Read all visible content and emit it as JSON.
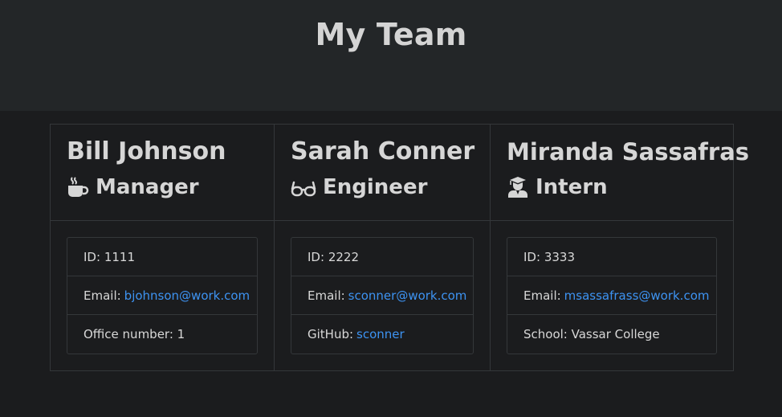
{
  "header": {
    "title": "My Team"
  },
  "colors": {
    "background": "#1b1c1e",
    "header_bg": "#232628",
    "link": "#3d93f2",
    "border": "#34373a"
  },
  "team": [
    {
      "name": "Bill Johnson",
      "role": "Manager",
      "icon": "coffee-icon",
      "id_label": "ID:",
      "id": "1111",
      "email_label": "Email:",
      "email": "bjohnson@work.com",
      "extra_label": "Office number:",
      "extra_value": "1"
    },
    {
      "name": "Sarah Conner",
      "role": "Engineer",
      "icon": "glasses-icon",
      "id_label": "ID:",
      "id": "2222",
      "email_label": "Email:",
      "email": "sconner@work.com",
      "extra_label": "GitHub:",
      "extra_value": "sconner"
    },
    {
      "name": "Miranda Sassafras",
      "role": "Intern",
      "icon": "graduate-icon",
      "id_label": "ID:",
      "id": "3333",
      "email_label": "Email:",
      "email": "msassafrass@work.com",
      "extra_label": "School:",
      "extra_value": "Vassar College"
    }
  ]
}
